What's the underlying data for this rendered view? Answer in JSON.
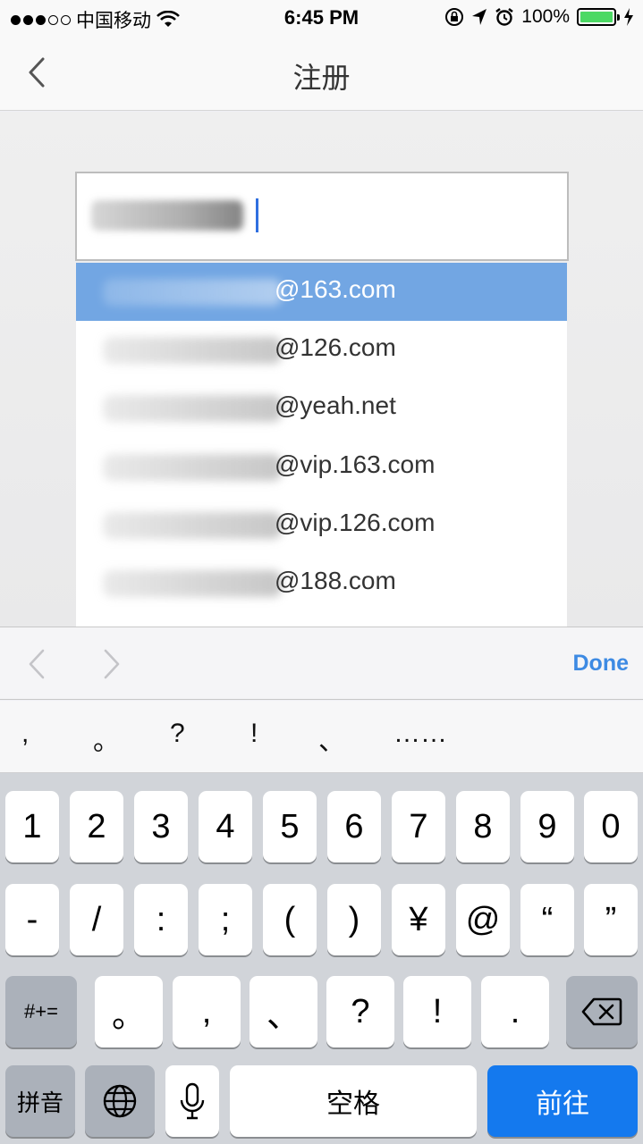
{
  "status_bar": {
    "carrier": "中国移动",
    "time": "6:45 PM",
    "battery": "100%",
    "icons": [
      "signal-dots-icon",
      "wifi-icon",
      "orientation-lock-icon",
      "location-arrow-icon",
      "alarm-icon",
      "battery-icon",
      "charging-bolt-icon"
    ]
  },
  "nav": {
    "title": "注册",
    "back_icon": "chevron-left-icon"
  },
  "suggestions": [
    {
      "domain": "@163.com",
      "selected": true
    },
    {
      "domain": "@126.com",
      "selected": false
    },
    {
      "domain": "@yeah.net",
      "selected": false
    },
    {
      "domain": "@vip.163.com",
      "selected": false
    },
    {
      "domain": "@vip.126.com",
      "selected": false
    },
    {
      "domain": "@188.com",
      "selected": false
    }
  ],
  "accessory": {
    "done_label": "Done"
  },
  "candidates": [
    ",",
    "。",
    "?",
    "!",
    "、",
    "……"
  ],
  "keyboard": {
    "row1": [
      "1",
      "2",
      "3",
      "4",
      "5",
      "6",
      "7",
      "8",
      "9",
      "0"
    ],
    "row2": [
      "-",
      "/",
      ":",
      ";",
      "(",
      ")",
      "¥",
      "@",
      "“",
      "”"
    ],
    "row3": [
      "#+=",
      "。",
      ",",
      "、",
      "?",
      "!",
      "."
    ],
    "pinyin_label": "拼音",
    "space_label": "空格",
    "go_label": "前往"
  },
  "colors": {
    "selected_row": "#72a6e3",
    "accent": "#3d8ae3",
    "go_key": "#1479ee",
    "battery_fill": "#4cd964",
    "caret": "#2f6fe0"
  }
}
